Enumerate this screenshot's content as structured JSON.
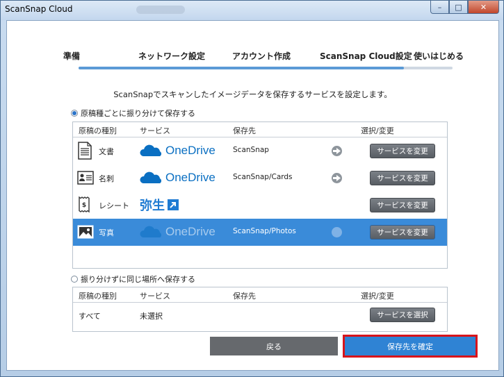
{
  "window": {
    "title": "ScanSnap Cloud"
  },
  "window_controls": {
    "minimize": "–",
    "maximize": "□",
    "close": "✕"
  },
  "steps": [
    {
      "label": "準備"
    },
    {
      "label": "ネットワーク設定"
    },
    {
      "label": "アカウント作成"
    },
    {
      "label": "ScanSnap Cloud設定"
    },
    {
      "label": "使いはじめる"
    }
  ],
  "progress": {
    "fraction": 0.87
  },
  "instruction": "ScanSnapでスキャンしたイメージデータを保存するサービスを設定します。",
  "option_sort": {
    "label": "原稿種ごとに振り分けて保存する",
    "selected": true
  },
  "option_single": {
    "label": "振り分けずに同じ場所へ保存する",
    "selected": false
  },
  "table1": {
    "headers": {
      "type": "原稿の種別",
      "service": "サービス",
      "destination": "保存先",
      "action": "選択/変更"
    },
    "rows": [
      {
        "icon": "document-icon",
        "type": "文書",
        "service": "OneDrive",
        "destination": "ScanSnap",
        "button": "サービスを変更",
        "selected": false
      },
      {
        "icon": "business-card-icon",
        "type": "名刺",
        "service": "OneDrive",
        "destination": "ScanSnap/Cards",
        "button": "サービスを変更",
        "selected": false
      },
      {
        "icon": "receipt-icon",
        "type": "レシート",
        "service": "弥生",
        "destination": "",
        "button": "サービスを変更",
        "selected": false
      },
      {
        "icon": "photo-icon",
        "type": "写真",
        "service": "OneDrive",
        "destination": "ScanSnap/Photos",
        "button": "サービスを変更",
        "selected": true
      }
    ]
  },
  "table2": {
    "headers": {
      "type": "原稿の種別",
      "service": "サービス",
      "destination": "保存先",
      "action": "選択/変更"
    },
    "row": {
      "type": "すべて",
      "service": "未選択",
      "button": "サービスを選択"
    }
  },
  "buttons": {
    "back": "戻る",
    "confirm": "保存先を確定"
  },
  "colors": {
    "accent": "#2f83d4",
    "selected_row": "#3a8bd9",
    "highlight": "#d8141b"
  }
}
